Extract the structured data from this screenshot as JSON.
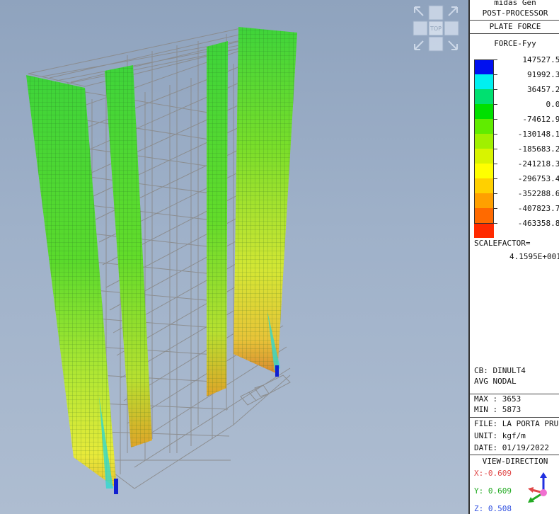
{
  "header": {
    "app": "midas Gen",
    "mode": "POST-PROCESSOR",
    "result": "PLATE FORCE",
    "component": "FORCE-Fyy"
  },
  "legend": {
    "values": [
      "147527.51",
      "91992.38",
      "36457.26",
      "0.00",
      "-74612.98",
      "-130148.11",
      "-185683.23",
      "-241218.35",
      "-296753.47",
      "-352288.60",
      "-407823.72",
      "-463358.84"
    ],
    "colors": [
      "#0010f0",
      "#00f0f0",
      "#00e070",
      "#00e000",
      "#60ec00",
      "#a0f000",
      "#d8f400",
      "#ffff00",
      "#ffd000",
      "#ffa000",
      "#ff6a00",
      "#ff2a00"
    ]
  },
  "scale": {
    "label": "SCALEFACTOR=",
    "value": "4.1595E+001"
  },
  "info": {
    "cb": "CB: DINULT4",
    "avg": "AVG NODAL",
    "max": "MAX : 3653",
    "min": "MIN : 5873",
    "file": "FILE: LA PORTA PRU",
    "unit": "UNIT: kgf/m",
    "date": "DATE: 01/19/2022"
  },
  "view": {
    "title": "VIEW-DIRECTION",
    "x": "X:-0.609",
    "y": "Y: 0.609",
    "z": "Z: 0.508",
    "x_color": "#e04848",
    "y_color": "#22aa22",
    "z_color": "#3050e0"
  },
  "viewcube": {
    "label": "TOP"
  }
}
